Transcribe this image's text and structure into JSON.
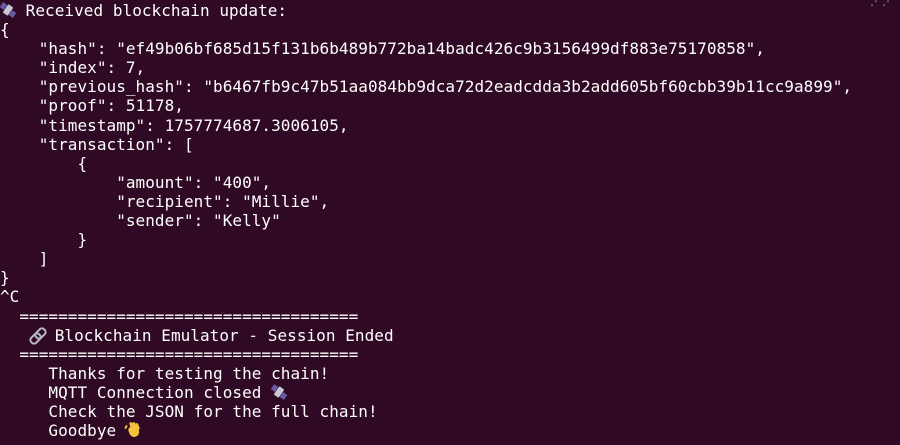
{
  "terminal": {
    "header_text": " Received blockchain update:",
    "json_lines": [
      "{",
      "    \"hash\": \"ef49b06bf685d15f131b6b489b772ba14badc426c9b3156499df883e75170858\",",
      "    \"index\": 7,",
      "    \"previous_hash\": \"b6467fb9c47b51aa084bb9dca72d2eadcdda3b2add605bf60cbb39b11cc9a899\",",
      "    \"proof\": 51178,",
      "    \"timestamp\": 1757774687.3006105,",
      "    \"transaction\": [",
      "        {",
      "            \"amount\": \"400\",",
      "            \"recipient\": \"Millie\",",
      "            \"sender\": \"Kelly\"",
      "        }",
      "    ]",
      "}"
    ],
    "interrupt": "^C",
    "separator": "  ===================================",
    "session_title": " Blockchain Emulator - Session Ended",
    "footer_lines": {
      "thanks": "     Thanks for testing the chain!",
      "mqtt": "     MQTT Connection closed ",
      "check": "     Check the JSON for the full chain!",
      "goodbye": "     Goodbye "
    },
    "icons": {
      "header": "satellite-icon",
      "title": "link-icon",
      "mqtt": "satellite-icon",
      "goodbye": "waving-hand-icon"
    },
    "colors": {
      "background": "#300a24",
      "foreground": "#ffffff"
    }
  }
}
